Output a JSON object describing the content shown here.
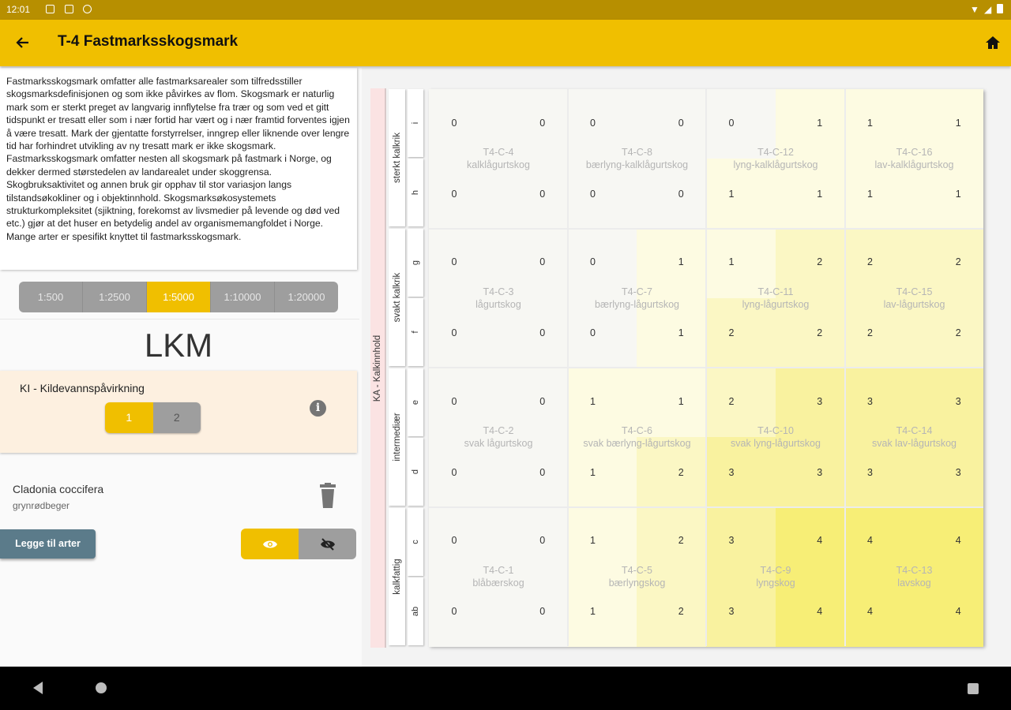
{
  "status_bar": {
    "time": "12:01"
  },
  "app_bar": {
    "title": "T-4 Fastmarksskogsmark"
  },
  "description": "Fastmarksskogsmark omfatter alle fastmarksarealer som tilfredsstiller skogsmarksdefinisjonen og som ikke påvirkes av flom. Skogsmark er naturlig mark som er sterkt preget av langvarig innflytelse fra trær og som ved et gitt tidspunkt er tresatt eller som i nær fortid har vært og i nær framtid forventes igjen å være tresatt. Mark der gjentatte forstyrrelser, inngrep eller liknende over lengre tid har forhindret utvikling av ny tresatt mark er ikke skogsmark. Fastmarksskogsmark omfatter nesten all skogsmark på fastmark i Norge, og dekker dermed størstedelen av landarealet under skoggrensa. Skogbruksaktivitet og annen bruk gir opphav til stor variasjon langs tilstandsøkokliner og i objektinnhold. Skogsmarksøkosystemets strukturkompleksitet (sjiktning, forekomst av livsmedier på levende og død ved etc.) gjør at det huser en betydelig andel av organismemangfoldet i Norge. Mange arter er spesifikt knyttet til fastmarksskogsmark.",
  "scales": [
    "1:500",
    "1:2500",
    "1:5000",
    "1:10000",
    "1:20000"
  ],
  "selected_scale": "1:5000",
  "lkm_heading": "LKM",
  "ki": {
    "label": "KI - Kildevannspåvirkning",
    "options": [
      "1",
      "2"
    ],
    "selected": "1",
    "info_icon": "info-icon"
  },
  "species": {
    "name": "Cladonia coccifera",
    "common_name": "grynrødbeger"
  },
  "add_species_label": "Legge til arter",
  "visibility_icons": {
    "show": "eye-icon",
    "hide": "eye-off-icon"
  },
  "matrix": {
    "ka_label": "KA - Kalkinnhold",
    "groups": [
      {
        "label": "sterkt kalkrik",
        "subs": [
          "i",
          "h"
        ]
      },
      {
        "label": "svakt kalkrik",
        "subs": [
          "g",
          "f"
        ]
      },
      {
        "label": "intermediær",
        "subs": [
          "e",
          "d"
        ]
      },
      {
        "label": "kalkfattig",
        "subs": [
          "c",
          "ab"
        ]
      }
    ],
    "values": [
      [
        0,
        0,
        0,
        0,
        0,
        1,
        1,
        1
      ],
      [
        0,
        0,
        0,
        0,
        1,
        1,
        1,
        1
      ],
      [
        0,
        0,
        0,
        1,
        1,
        2,
        2,
        2
      ],
      [
        0,
        0,
        0,
        1,
        2,
        2,
        2,
        2
      ],
      [
        0,
        0,
        1,
        1,
        2,
        3,
        3,
        3
      ],
      [
        0,
        0,
        1,
        2,
        3,
        3,
        3,
        3
      ],
      [
        0,
        0,
        1,
        2,
        3,
        4,
        4,
        4
      ],
      [
        0,
        0,
        1,
        2,
        3,
        4,
        4,
        4
      ]
    ],
    "types": [
      [
        "T4-C-4\nkalklågurtskog",
        "T4-C-8\nbærlyng-kalklågurtskog",
        "T4-C-12\nlyng-kalklågurtskog",
        "T4-C-16\nlav-kalklågurtskog"
      ],
      [
        "T4-C-3\nlågurtskog",
        "T4-C-7\nbærlyng-lågurtskog",
        "T4-C-11\nlyng-lågurtskog",
        "T4-C-15\nlav-lågurtskog"
      ],
      [
        "T4-C-2\nsvak lågurtskog",
        "T4-C-6\nsvak bærlyng-lågurtskog",
        "T4-C-10\nsvak lyng-lågurtskog",
        "T4-C-14\nsvak lav-lågurtskog"
      ],
      [
        "T4-C-1\nblåbærskog",
        "T4-C-5\nbærlyngskog",
        "T4-C-9\nlyngskog",
        "T4-C-13\nlavskog"
      ]
    ],
    "colors": {
      "0": "#f7f7f3",
      "1": "#fdfbe2",
      "2": "#fbf7c4",
      "3": "#f9f29f",
      "4": "#f7ee76"
    }
  }
}
